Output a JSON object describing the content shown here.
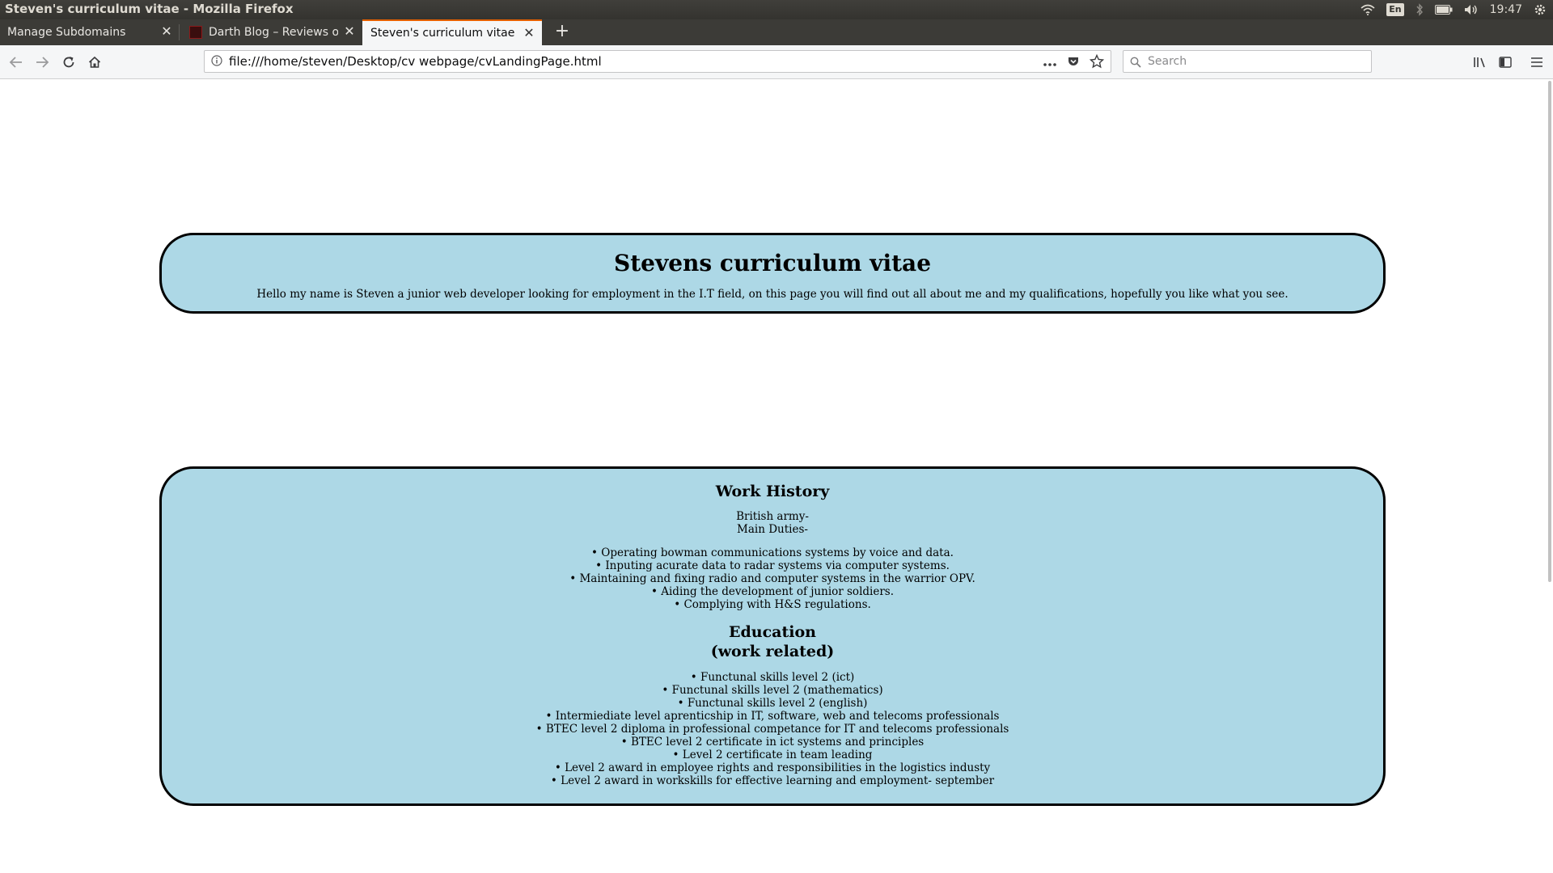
{
  "os": {
    "window_title": "Steven's curriculum vitae - Mozilla Firefox",
    "lang": "En",
    "clock": "19:47"
  },
  "tabs": [
    {
      "label": "Manage Subdomains"
    },
    {
      "label": "Darth Blog – Reviews of"
    },
    {
      "label": "Steven's curriculum vitae"
    }
  ],
  "navbar": {
    "url": "file:///home/steven/Desktop/cv webpage/cvLandingPage.html",
    "search_placeholder": "Search"
  },
  "page": {
    "intro": {
      "title": "Stevens curriculum vitae",
      "text": "Hello my name is Steven a junior web developer looking for employment in the I.T field, on this page you will find out all about me and my qualifications, hopefully you like what you see."
    },
    "work": {
      "title": "Work History",
      "employer": "British army-",
      "duties_label": "Main Duties-",
      "duties": [
        "• Operating bowman communications systems by voice and data.",
        "• Inputing acurate data to radar systems via computer systems.",
        "• Maintaining and fixing radio and computer systems in the warrior OPV.",
        "• Aiding the development of junior soldiers.",
        "• Complying with H&S regulations."
      ]
    },
    "education": {
      "title_line1": "Education",
      "title_line2": "(work related)",
      "items": [
        "• Functunal skills level 2 (ict)",
        "• Functunal skills level 2 (mathematics)",
        "• Functunal skills level 2 (english)",
        "• Intermiediate level aprenticship in IT, software, web and telecoms professionals",
        "• BTEC level 2 diploma in professional competance for IT and telecoms professionals",
        "• BTEC level 2 certificate in ict systems and principles",
        "• Level 2 certificate in team leading",
        "• Level 2 award in employee rights and responsibilities in the logistics industy",
        "• Level 2 award in workskills for effective learning and employment- september"
      ]
    }
  }
}
